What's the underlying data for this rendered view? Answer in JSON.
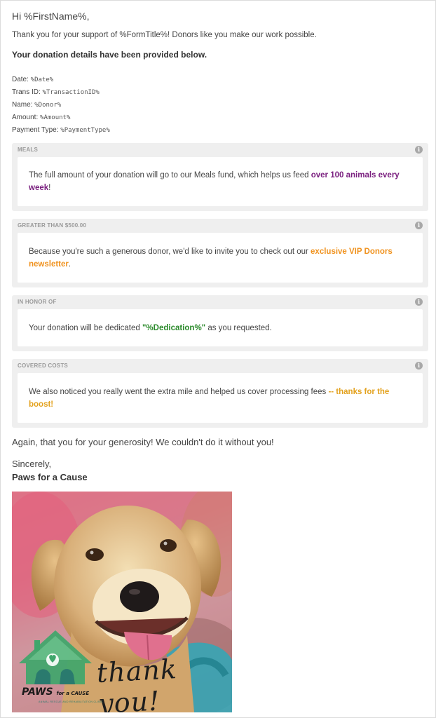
{
  "email": {
    "greeting": "Hi %FirstName%,",
    "intro": "Thank you for your support of %FormTitle%! Donors like you make our work possible.",
    "details_heading": "Your donation details have been provided below.",
    "details": [
      {
        "label": "Date: ",
        "value": "%Date%"
      },
      {
        "label": "Trans ID: ",
        "value": "%TransactionID%"
      },
      {
        "label": "Name: ",
        "value": "%Donor%"
      },
      {
        "label": "Amount: ",
        "value": "%Amount%"
      },
      {
        "label": "Payment Type: ",
        "value": "%PaymentType%"
      }
    ],
    "blocks": [
      {
        "title": "MEALS",
        "text_before": "The full amount of your donation will go to our Meals fund, which helps us feed ",
        "highlight": "over 100 animals every week",
        "text_after": "!",
        "highlight_color": "#7a1f7f"
      },
      {
        "title": "GREATER THAN $500.00",
        "text_before": "Because you're such a generous donor, we'd like to invite you to check out our ",
        "highlight": "exclusive VIP Donors newsletter",
        "text_after": ".",
        "highlight_color": "#f0921e"
      },
      {
        "title": "IN HONOR OF",
        "text_before": "Your donation will be dedicated ",
        "highlight": "\"%Dedication%\"",
        "text_after": " as you requested.",
        "highlight_color": "#2b8a2b"
      },
      {
        "title": "COVERED COSTS",
        "text_before": "We also noticed you really went the extra mile and helped us cover processing fees ",
        "highlight": "-- thanks for the boost!",
        "text_after": "",
        "highlight_color": "#e3a21f"
      }
    ],
    "info_icon": "info-icon",
    "closing": "Again, that you for your generosity! We couldn't do it without you!",
    "sincerely": "Sincerely,",
    "signature": "Paws for a Cause",
    "image": {
      "thanks_text": "thank you!",
      "logo_main": "PAWS",
      "logo_small": "for a CAUSE",
      "logo_sub": "ANIMAL RESCUE AND REHABILITATION CLINIC"
    }
  }
}
